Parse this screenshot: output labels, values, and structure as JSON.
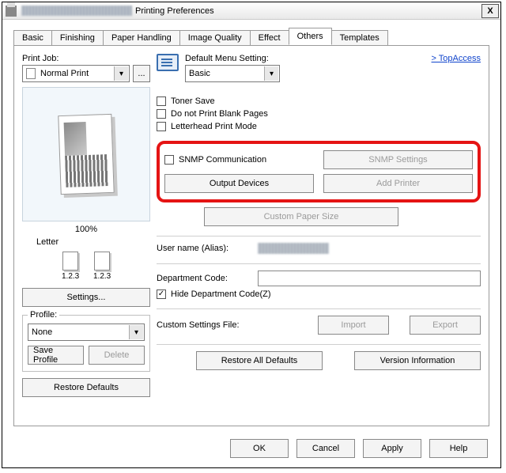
{
  "window": {
    "title_suffix": "Printing Preferences",
    "close": "X"
  },
  "tabs": {
    "basic": "Basic",
    "finishing": "Finishing",
    "paper": "Paper Handling",
    "image": "Image Quality",
    "effect": "Effect",
    "others": "Others",
    "templates": "Templates"
  },
  "left": {
    "print_job_label": "Print Job:",
    "print_job_value": "Normal Print",
    "ellipsis": "...",
    "zoom": "100%",
    "paper": "Letter",
    "mini1": "1.2.3",
    "mini2": "1.2.3",
    "settings_btn": "Settings...",
    "profile_label": "Profile:",
    "profile_value": "None",
    "save_profile": "Save Profile",
    "delete": "Delete",
    "restore": "Restore Defaults"
  },
  "right": {
    "default_menu_label": "Default Menu Setting:",
    "default_menu_value": "Basic",
    "topaccess": ">  TopAccess",
    "toner_save": "Toner Save",
    "blank_pages": "Do not Print Blank Pages",
    "letterhead": "Letterhead Print Mode",
    "snmp_comm": "SNMP Communication",
    "snmp_settings": "SNMP Settings",
    "output_devices": "Output Devices",
    "add_printer": "Add Printer",
    "custom_paper": "Custom Paper Size",
    "username_label": "User name (Alias):",
    "dept_label": "Department Code:",
    "hide_dept": "Hide Department Code(Z)",
    "custom_file_label": "Custom Settings File:",
    "import": "Import",
    "export": "Export",
    "restore_all": "Restore All Defaults",
    "version_info": "Version Information"
  },
  "bottom": {
    "ok": "OK",
    "cancel": "Cancel",
    "apply": "Apply",
    "help": "Help"
  }
}
